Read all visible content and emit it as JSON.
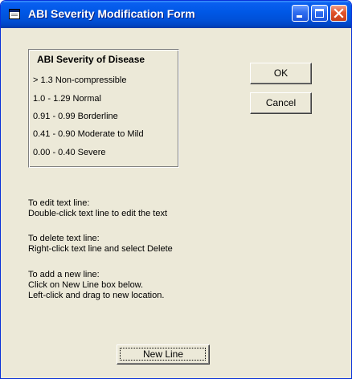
{
  "window": {
    "title": "ABI Severity Modification Form",
    "title_icon": "form-icon",
    "controls": [
      "minimize-icon",
      "maximize-icon",
      "close-icon"
    ]
  },
  "severity_box": {
    "heading": "ABI Severity of Disease",
    "lines": [
      "> 1.3 Non-compressible",
      "1.0 - 1.29 Normal",
      "0.91 - 0.99 Borderline",
      "0.41 - 0.90 Moderate to Mild",
      "0.00 - 0.40  Severe"
    ]
  },
  "buttons": {
    "ok": "OK",
    "cancel": "Cancel",
    "new_line": "New Line"
  },
  "instructions": {
    "edit_title": "To edit text line:",
    "edit_detail": "Double-click text line to edit the text",
    "delete_title": "To delete text line:",
    "delete_detail": "Right-click text line and select Delete",
    "add_title": "To add a new line:",
    "add_detail_1": "Click on New Line box below.",
    "add_detail_2": "Left-click and drag to new location."
  },
  "colors": {
    "title_bar": "#0058e6",
    "window_face": "#ece9d8",
    "close_button": "#e0542a"
  }
}
